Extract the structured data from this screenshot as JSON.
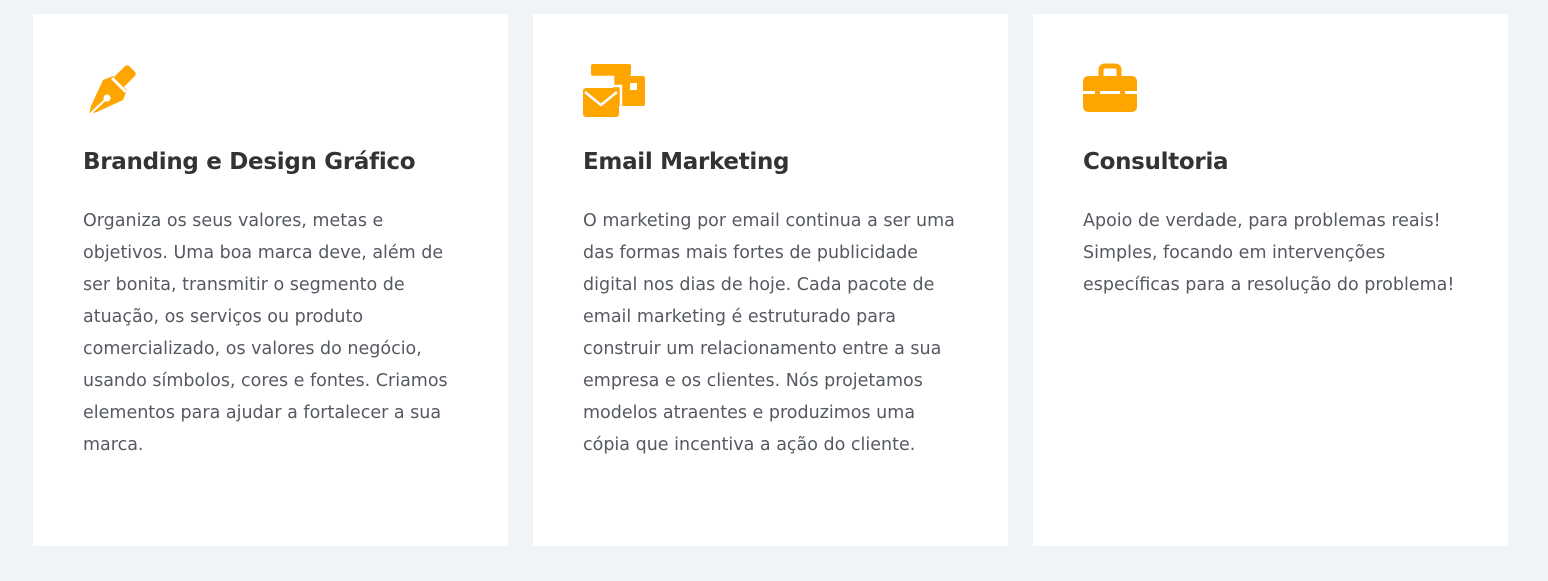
{
  "accent_color": "#ffa500",
  "cards": [
    {
      "icon": "pen-nib-icon",
      "title": "Branding e Design Gráfico",
      "text": "Organiza os seus valores, metas e objetivos. Uma boa marca deve, além de ser bonita, transmitir o segmento de atuação, os serviços ou produto comercializado, os valores do negócio, usando símbolos, cores e fontes. Criamos elementos para ajudar a fortalecer a sua marca."
    },
    {
      "icon": "envelope-stack-icon",
      "title": "Email Marketing",
      "text": "O marketing por email continua a ser uma das formas mais fortes de publicidade digital nos dias de hoje. Cada pacote de email marketing é estruturado para construir um relacionamento entre a sua empresa e os clientes. Nós projetamos modelos atraentes e produzimos uma cópia que incentiva a ação do cliente."
    },
    {
      "icon": "toolbox-icon",
      "title": "Consultoria",
      "text": "Apoio de verdade, para problemas reais! Simples, focando em intervenções específicas para a resolução do problema!"
    }
  ]
}
